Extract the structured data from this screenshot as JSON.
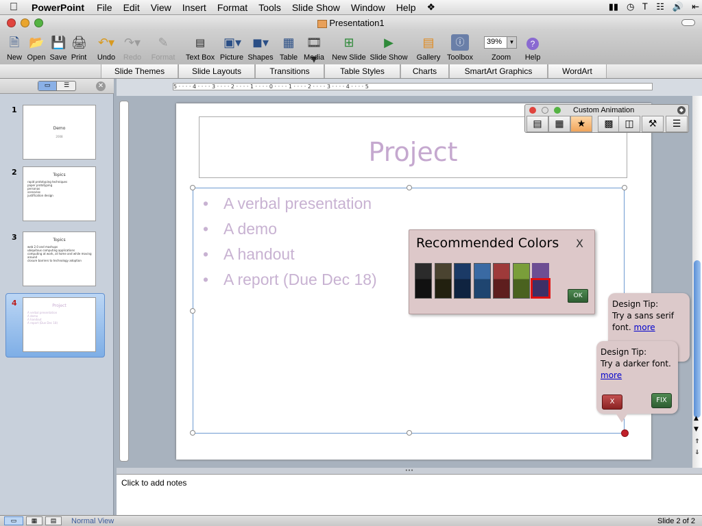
{
  "menubar": {
    "apple": "",
    "app": "PowerPoint",
    "items": [
      "File",
      "Edit",
      "View",
      "Insert",
      "Format",
      "Tools",
      "Slide Show",
      "Window",
      "Help"
    ]
  },
  "window": {
    "title": "Presentation1"
  },
  "toolbar": {
    "new": "New",
    "open": "Open",
    "save": "Save",
    "print": "Print",
    "undo": "Undo",
    "redo": "Redo",
    "format": "Format",
    "textbox": "Text Box",
    "picture": "Picture",
    "shapes": "Shapes",
    "table": "Table",
    "media": "Media",
    "newslide": "New Slide",
    "slideshow": "Slide Show",
    "gallery": "Gallery",
    "toolbox": "Toolbox",
    "zoom_label": "Zoom",
    "zoom_value": "39%",
    "help": "Help"
  },
  "ribbon": {
    "tabs": [
      "Slide Themes",
      "Slide Layouts",
      "Transitions",
      "Table Styles",
      "Charts",
      "SmartArt Graphics",
      "WordArt"
    ]
  },
  "thumbnails": [
    {
      "num": "1",
      "title": "Demo",
      "sub": "2008"
    },
    {
      "num": "2",
      "title": "Topics",
      "lines": [
        "rapid prototyping techniques",
        "paper prototyping",
        "personas",
        "scenarios",
        "justification design"
      ]
    },
    {
      "num": "3",
      "title": "Topics",
      "lines": [
        "web 2.0 and mashups",
        "ubiquitous computing applications",
        "computing at work, at home and while moving around",
        "closure barriers to technology adoption"
      ]
    },
    {
      "num": "4",
      "title": "Project",
      "lines": [
        "A verbal presentation",
        "A demo",
        "A handout",
        "A report (Due Dec 18)"
      ]
    }
  ],
  "ruler": {
    "marks": "5 · · · · 4 · · · · 3 · · · · 2 · · · · 1 · · · · 0 · · · · 1 · · · · 2 · · · · 3 · · · · 4 · · · · 5"
  },
  "slide": {
    "title": "Project",
    "bullets": [
      "A verbal presentation",
      "A demo",
      "A handout",
      "A report (Due Dec 18)"
    ]
  },
  "animation_palette": {
    "title": "Custom Animation"
  },
  "recommended_colors": {
    "title": "Recommended Colors",
    "close": "X",
    "ok": "OK",
    "swatches": [
      {
        "top": "#2b2b2b",
        "bottom": "#111111"
      },
      {
        "top": "#4a4330",
        "bottom": "#22200f"
      },
      {
        "top": "#1b3a66",
        "bottom": "#0f2340"
      },
      {
        "top": "#3a6aa3",
        "bottom": "#1f4570"
      },
      {
        "top": "#9e3a3a",
        "bottom": "#5e1e1e"
      },
      {
        "top": "#7a9e3a",
        "bottom": "#4a621f"
      },
      {
        "top": "#6d4e93",
        "bottom": "#3d2f66"
      }
    ],
    "selected_index": 6
  },
  "tip1": {
    "head": "Design Tip:",
    "text": "Try a sans serif font.",
    "more": "more"
  },
  "tip2": {
    "head": "Design Tip:",
    "text": "Try a darker font.",
    "more": "more",
    "dismiss": "X",
    "fix": "FIX"
  },
  "notes": {
    "placeholder": "Click to add notes"
  },
  "status": {
    "view": "Normal View",
    "slide": "Slide 2 of 2"
  }
}
